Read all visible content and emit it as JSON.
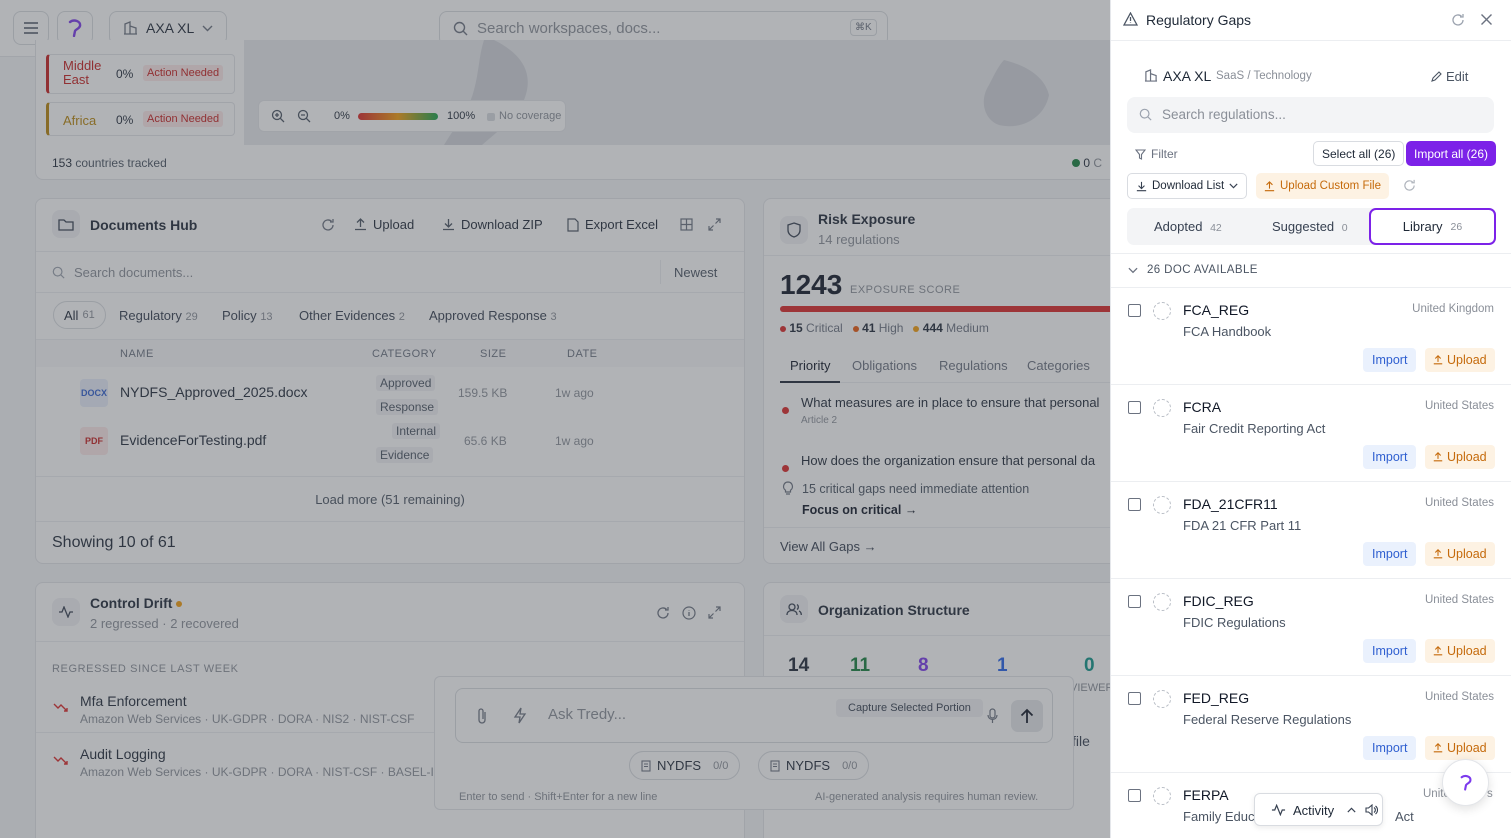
{
  "topbar": {
    "org_name": "AXA XL",
    "search_placeholder": "Search workspaces, docs...",
    "search_shortcut": "⌘K"
  },
  "map_widget": {
    "regions": [
      {
        "name": "Middle East",
        "line1": "Middle",
        "line2": "East",
        "pct": "0%",
        "status": "Action Needed",
        "color": "#c81e1e"
      },
      {
        "name": "Africa",
        "pct": "0%",
        "status": "Action Needed",
        "color": "#b8860b"
      }
    ],
    "legend_min": "0%",
    "legend_max": "100%",
    "legend_none": "No coverage",
    "countries_count": "153",
    "countries_label": "countries tracked",
    "legend_right_value": "0",
    "legend_right_text": "C"
  },
  "documents_hub": {
    "title": "Documents Hub",
    "upload": "Upload",
    "download_zip": "Download ZIP",
    "export_excel": "Export Excel",
    "search_placeholder": "Search documents...",
    "sort": "Newest",
    "tabs": [
      {
        "label": "All",
        "count": "61"
      },
      {
        "label": "Regulatory",
        "count": "29"
      },
      {
        "label": "Policy",
        "count": "13"
      },
      {
        "label": "Other Evidences",
        "count": "2"
      },
      {
        "label": "Approved Response",
        "count": "3"
      }
    ],
    "columns": {
      "name": "NAME",
      "category": "CATEGORY",
      "size": "SIZE",
      "date": "DATE"
    },
    "rows": [
      {
        "type": "DOCX",
        "name": "NYDFS_Approved_2025.docx",
        "cat1": "Approved",
        "cat2": "Response",
        "size": "159.5 KB",
        "date": "1w ago"
      },
      {
        "type": "PDF",
        "name": "EvidenceForTesting.pdf",
        "cat1": "Internal",
        "cat2": "Evidence",
        "size": "65.6 KB",
        "date": "1w ago"
      }
    ],
    "load_more": "Load more (51 remaining)",
    "showing": "Showing 10 of 61"
  },
  "risk_exposure": {
    "title": "Risk Exposure",
    "subtitle": "14 regulations",
    "score": "1243",
    "score_label": "EXPOSURE SCORE",
    "critical_count": "15",
    "critical_label": "Critical",
    "high_count": "41",
    "high_label": "High",
    "medium_count": "444",
    "medium_label": "Medium",
    "tabs": [
      "Priority",
      "Obligations",
      "Regulations",
      "Categories"
    ],
    "items": [
      {
        "text": "What measures are in place to ensure that personal",
        "sub": "Article 2"
      },
      {
        "text": "How does the organization ensure that personal da",
        "sub": ""
      }
    ],
    "tip": "15 critical gaps need immediate attention",
    "focus": "Focus on critical",
    "view_all": "View All Gaps"
  },
  "control_drift": {
    "title": "Control Drift",
    "subtitle": "2 regressed · 2 recovered",
    "section": "REGRESSED SINCE LAST WEEK",
    "items": [
      {
        "name": "Mfa Enforcement",
        "meta": "Amazon Web Services · UK-GDPR · DORA · NIS2 · NIST-CSF"
      },
      {
        "name": "Audit Logging",
        "meta": "Amazon Web Services · UK-GDPR · DORA · NIST-CSF · BASEL-III"
      }
    ]
  },
  "org_structure": {
    "title": "Organization Structure",
    "stats": [
      {
        "value": "14",
        "color": "#1f2937"
      },
      {
        "value": "11",
        "color": "#15803d"
      },
      {
        "value": "8",
        "color": "#7c3aed"
      },
      {
        "value": "1",
        "color": "#2563eb"
      },
      {
        "value": "0",
        "color": "#0d9488"
      }
    ],
    "viewer_label": "VIEWER",
    "file_label": "file"
  },
  "chat": {
    "placeholder": "Ask Tredy...",
    "capture": "Capture Selected Portion",
    "chips": [
      {
        "label": "NYDFS",
        "count": "0/0"
      },
      {
        "label": "NYDFS",
        "count": "0/0"
      }
    ],
    "hint_left": "Enter to send · Shift+Enter for a new line",
    "hint_right": "AI-generated analysis requires human review."
  },
  "panel": {
    "title": "Regulatory Gaps",
    "org_name": "AXA XL",
    "org_sector": "SaaS / Technology",
    "edit": "Edit",
    "search_placeholder": "Search regulations...",
    "filter": "Filter",
    "select_all": "Select all (26)",
    "import_all": "Import all (26)",
    "download_list": "Download List",
    "upload_custom": "Upload Custom File",
    "tabs": [
      {
        "label": "Adopted",
        "count": "42"
      },
      {
        "label": "Suggested",
        "count": "0"
      },
      {
        "label": "Library",
        "count": "26"
      }
    ],
    "available": "26 DOC AVAILABLE",
    "import_label": "Import",
    "upload_label": "Upload",
    "items": [
      {
        "code": "FCA_REG",
        "name": "FCA Handbook",
        "country": "United Kingdom"
      },
      {
        "code": "FCRA",
        "name": "Fair Credit Reporting Act",
        "country": "United States"
      },
      {
        "code": "FDA_21CFR11",
        "name": "FDA 21 CFR Part 11",
        "country": "United States"
      },
      {
        "code": "FDIC_REG",
        "name": "FDIC Regulations",
        "country": "United States"
      },
      {
        "code": "FED_REG",
        "name": "Federal Reserve Regulations",
        "country": "United States"
      },
      {
        "code": "FERPA",
        "name": "Family Educa",
        "name_tail": "Act",
        "country": "Unite",
        "country_tail": "s"
      }
    ]
  },
  "activity": {
    "label": "Activity"
  }
}
